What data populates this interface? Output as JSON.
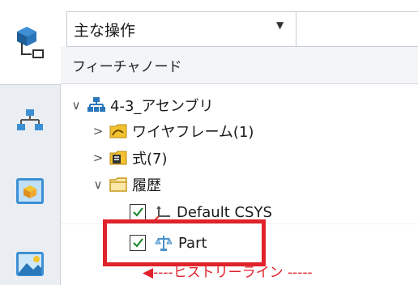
{
  "toolbar": {
    "combo_value": "主な操作",
    "combo_arrow": "▼"
  },
  "header": {
    "title": "フィーチャノード"
  },
  "tree": {
    "assembly": {
      "chevron": "∨",
      "label": "4-3_アセンブリ",
      "icon": "assembly-icon"
    },
    "wireframe": {
      "chevron": ">",
      "label": "ワイヤフレーム(1)",
      "icon": "wireframe-icon"
    },
    "expressions": {
      "chevron": ">",
      "label": "式(7)",
      "icon": "expression-icon"
    },
    "history": {
      "chevron": "∨",
      "label": "履歴",
      "icon": "folder-icon"
    },
    "default_csys": {
      "label": "Default CSYS",
      "checked": true,
      "icon": "csys-icon"
    },
    "part": {
      "label": "Part",
      "checked": true,
      "icon": "part-icon"
    },
    "history_line": "◀----ヒストリーライン -----"
  },
  "left_tabs": [
    {
      "icon": "feature-tree-icon"
    },
    {
      "icon": "assembly-navigator-icon"
    },
    {
      "icon": "part-library-icon"
    },
    {
      "icon": "resource-icon"
    }
  ],
  "colors": {
    "highlight": "#e0232b",
    "check": "#1e8a2e"
  }
}
